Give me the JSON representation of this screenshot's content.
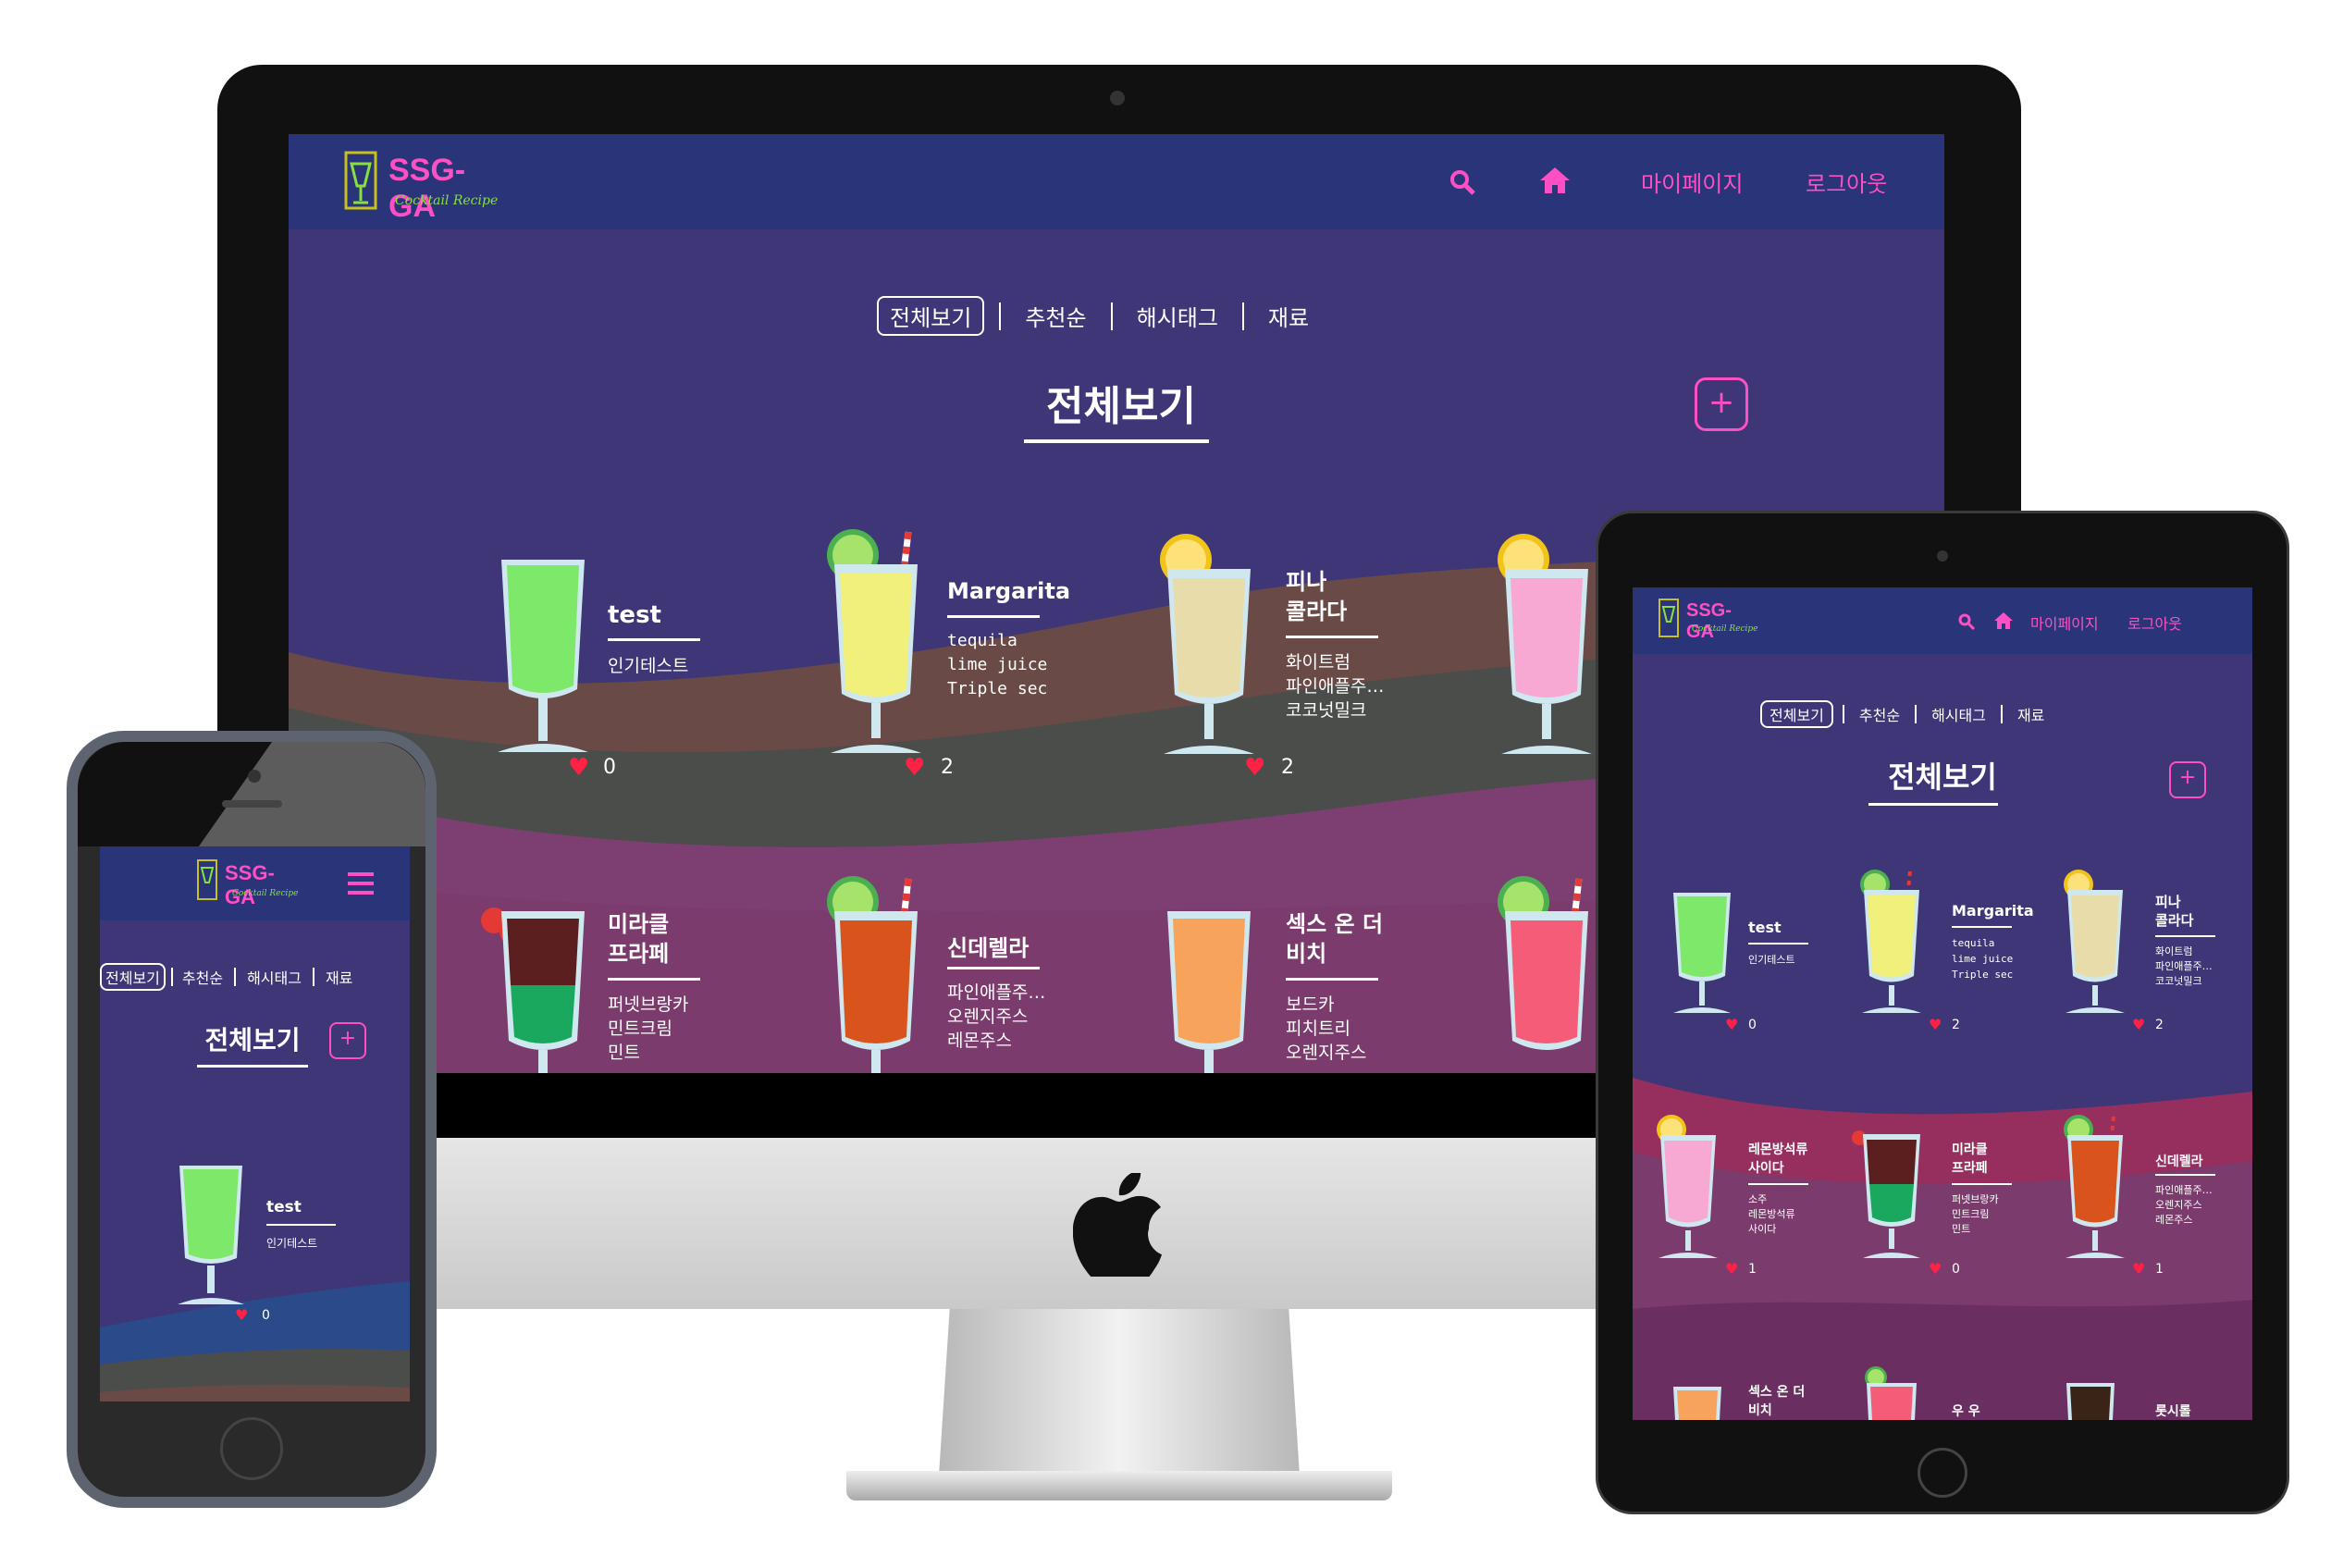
{
  "site": {
    "logo_text": "SSG-GA",
    "logo_subtitle": "Cocktail Recipe",
    "nav_mypage": "마이페이지",
    "nav_logout": "로그아웃"
  },
  "filters": [
    "전체보기",
    "추천순",
    "해시태그",
    "재료"
  ],
  "page_title": "전체보기",
  "add_symbol": "+",
  "colors": {
    "nav_bg": "#293578",
    "page_bg": "#3e3677",
    "accent": "#ff4fc5",
    "logo_green": "#88e040",
    "heart": "#ff2244"
  },
  "desktop": {
    "cards_row1": [
      {
        "name": "test",
        "ingredients": "인기테스트",
        "likes": "0"
      },
      {
        "name": "Margarita",
        "ingredients": "tequila\nlime juice\nTriple sec",
        "likes": "2"
      },
      {
        "name": "피나\n콜라다",
        "ingredients": "화이트럼\n파인애플주…\n코코넛밀크",
        "likes": "2"
      }
    ],
    "cards_row2": [
      {
        "name": "미라클\n프라페",
        "ingredients": "퍼넷브랑카\n민트크림\n민트"
      },
      {
        "name": "신데렐라",
        "ingredients": "파인애플주…\n오렌지주스\n레몬주스"
      },
      {
        "name": "섹스 온 더\n비치",
        "ingredients": "보드카\n피치트리\n오렌지주스"
      }
    ]
  },
  "tablet": {
    "row1": [
      {
        "name": "test",
        "ingredients": "인기테스트",
        "likes": "0"
      },
      {
        "name": "Margarita",
        "ingredients": "tequila\nlime juice\nTriple sec",
        "likes": "2"
      },
      {
        "name": "피나\n콜라다",
        "ingredients": "화이트럼\n파인애플주…\n코코넛밀크",
        "likes": "2"
      }
    ],
    "row2": [
      {
        "name": "레몬방석류\n사이다",
        "ingredients": "소주\n레몬방석류\n사이다",
        "likes": "1"
      },
      {
        "name": "미라클\n프라페",
        "ingredients": "퍼넷브랑카\n민트크림\n민트",
        "likes": "0"
      },
      {
        "name": "신데렐라",
        "ingredients": "파인애플주…\n오렌지주스\n레몬주스",
        "likes": "1"
      }
    ],
    "row3": [
      {
        "name": "섹스 온 더\n비치"
      },
      {
        "name": "우 우"
      },
      {
        "name": "롯시롤"
      }
    ]
  },
  "phone": {
    "card": {
      "name": "test",
      "ingredients": "인기테스트",
      "likes": "0"
    }
  }
}
